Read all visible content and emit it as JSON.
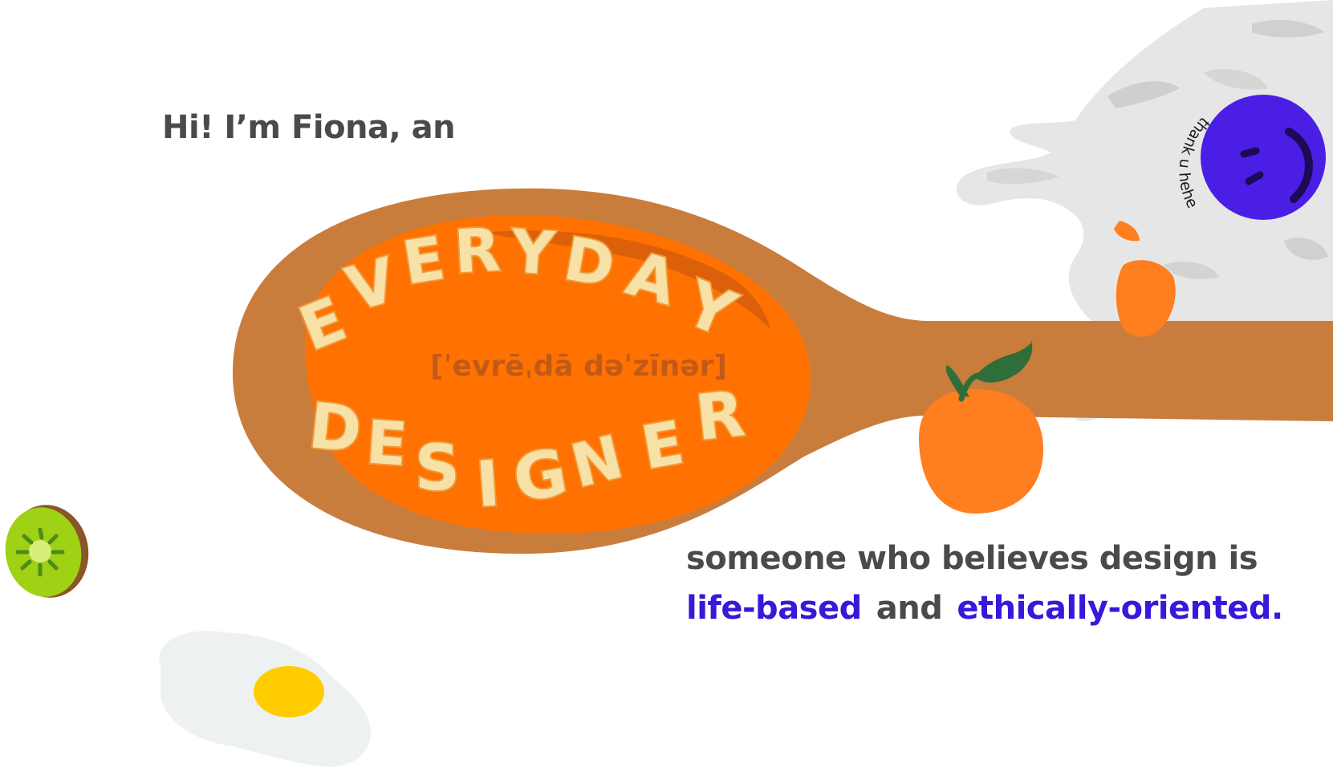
{
  "intro": {
    "text": "Hi! I’m Fiona, an"
  },
  "headline": {
    "word1": [
      "E",
      "V",
      "E",
      "R",
      "Y",
      "D",
      "A",
      "Y"
    ],
    "word2": [
      "D",
      "E",
      "S",
      "I",
      "G",
      "N",
      "E",
      "R"
    ],
    "phonetic": "[ˈevrēˌdā  dəˈzīnər]"
  },
  "tagline": {
    "line1": "someone who believes design is",
    "highlight1": "life-based",
    "connector": "and",
    "highlight2": "ethically-oriented."
  },
  "badge": {
    "text": "thank u hehe"
  },
  "colors": {
    "spoon": "#c97d3d",
    "soup": "#ff7100",
    "accent": "#3a17d9",
    "text": "#4a4a4a",
    "smiley": "#4b1ee6"
  },
  "icons": [
    "wooden-spoon-icon",
    "tangerine-icon",
    "smiley-icon",
    "kiwi-icon",
    "fried-egg-icon",
    "milk-splash-icon"
  ]
}
